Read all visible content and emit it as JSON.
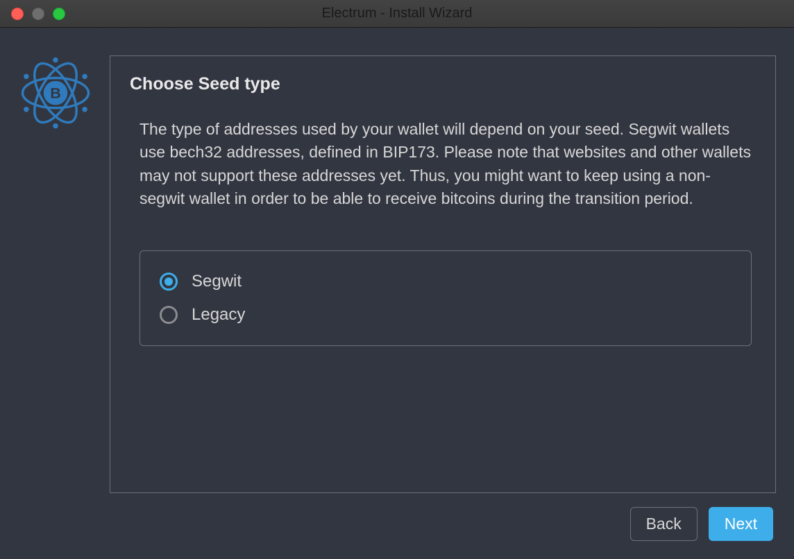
{
  "window": {
    "title": "Electrum  -  Install Wizard"
  },
  "panel": {
    "heading": "Choose Seed type",
    "description": "The type of addresses used by your wallet will depend on your seed. Segwit wallets use bech32 addresses, defined in BIP173. Please note that websites and other wallets may not support these addresses yet. Thus, you might want to keep using a non-segwit wallet in order to be able to receive bitcoins during the transition period."
  },
  "options": [
    {
      "label": "Segwit",
      "selected": true
    },
    {
      "label": "Legacy",
      "selected": false
    }
  ],
  "buttons": {
    "back": "Back",
    "next": "Next"
  },
  "colors": {
    "accent": "#3daee9",
    "bg": "#323641",
    "text": "#d7d7d7"
  }
}
